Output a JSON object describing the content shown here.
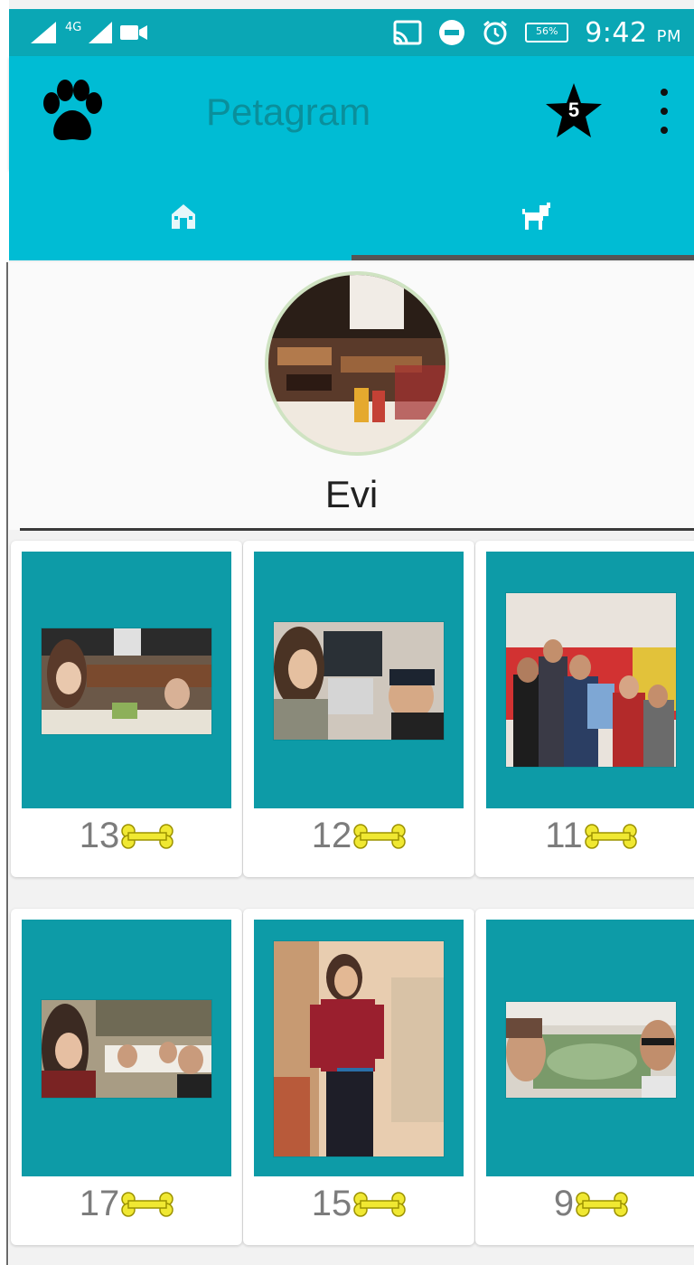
{
  "status_bar": {
    "network_label": "4G",
    "battery_percent": "56%",
    "time": "9:42",
    "ampm": "PM"
  },
  "app_bar": {
    "title": "Petagram",
    "favorites_count": "5"
  },
  "tabs": [
    {
      "name": "home",
      "icon": "house-icon",
      "selected": false
    },
    {
      "name": "profile",
      "icon": "dog-icon",
      "selected": true
    }
  ],
  "profile": {
    "name": "Evi"
  },
  "photos": [
    {
      "likes": "13"
    },
    {
      "likes": "12"
    },
    {
      "likes": "11"
    },
    {
      "likes": "17"
    },
    {
      "likes": "15"
    },
    {
      "likes": "9"
    }
  ],
  "colors": {
    "primary": "#00bcd4",
    "primary_dark": "#0aa7b5",
    "card_media": "#0d9ba7",
    "bone": "#f0e832"
  }
}
